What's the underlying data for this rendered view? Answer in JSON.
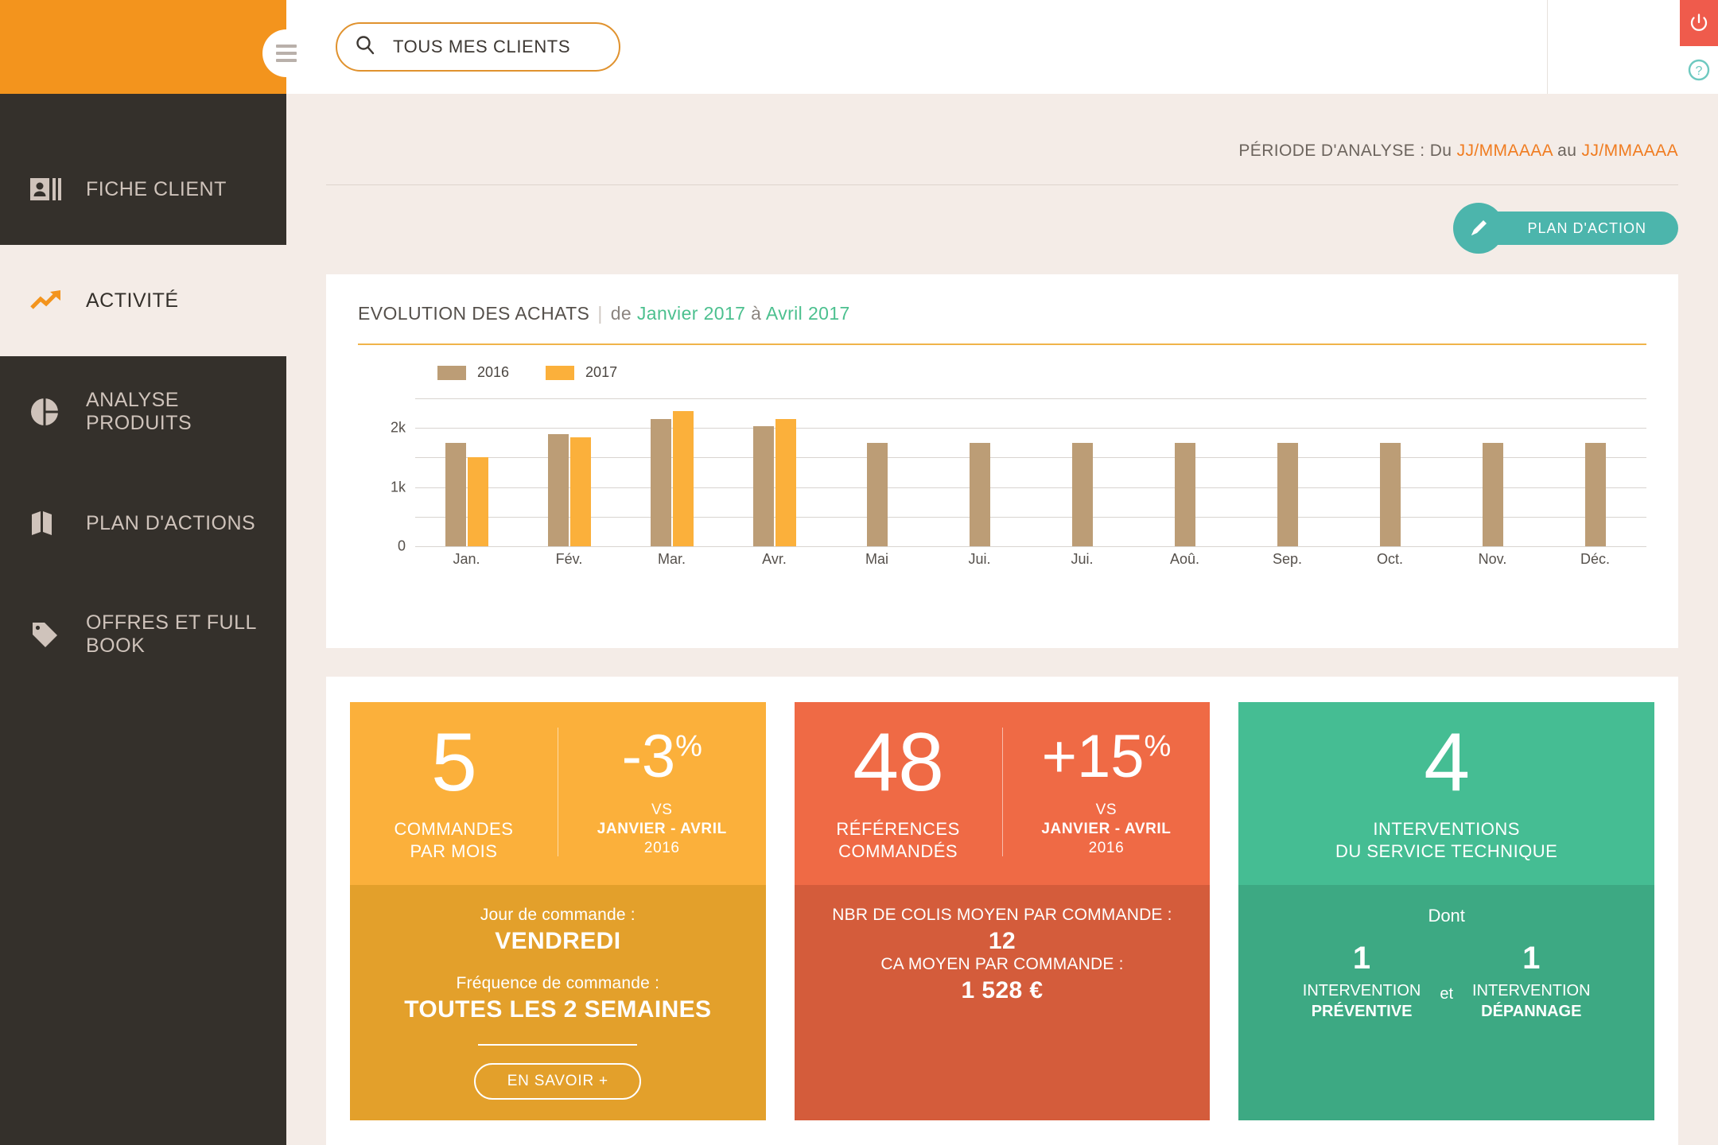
{
  "brand": {
    "accent_orange": "#f3941d",
    "sidebar_bg": "#34302b",
    "page_bg": "#f4ece7"
  },
  "topbar": {
    "hamburger_icon": "hamburger-icon",
    "search": {
      "icon": "search-icon",
      "value": "TOUS MES CLIENTS",
      "placeholder": "TOUS MES CLIENTS"
    },
    "power_icon": "power-icon",
    "help_icon": "help-icon",
    "power_color": "#ef5b4c",
    "help_color": "#6ec9c0"
  },
  "sidebar": {
    "items": [
      {
        "label": "FICHE CLIENT",
        "icon": "contact-card-icon",
        "active": false
      },
      {
        "label": "ACTIVITÉ",
        "icon": "trending-up-icon",
        "active": true
      },
      {
        "label": "ANALYSE PRODUITS",
        "icon": "pie-chart-icon",
        "active": false
      },
      {
        "label": "PLAN D'ACTIONS",
        "icon": "map-icon",
        "active": false
      },
      {
        "label": "OFFRES ET FULL BOOK",
        "icon": "tag-icon",
        "active": false
      }
    ]
  },
  "period": {
    "prefix": "PÉRIODE D'ANALYSE : Du ",
    "from": "JJ/MMAAAA",
    "middle": " au ",
    "to": "JJ/MMAAAA"
  },
  "plan_button": {
    "label": "PLAN D'ACTION",
    "icon": "pencil-icon",
    "color": "#4cb5ac"
  },
  "chart_card": {
    "title": "EVOLUTION DES ACHATS",
    "separator": "|",
    "subtitle_prefix": "de ",
    "subtitle_from": "Janvier 2017",
    "subtitle_mid": " à ",
    "subtitle_to": "Avril 2017"
  },
  "chart_data": {
    "type": "bar",
    "title": "EVOLUTION DES ACHATS",
    "subtitle": "de Janvier 2017 à Avril 2017",
    "xlabel": "",
    "ylabel": "",
    "ylim": [
      0,
      2500
    ],
    "yticks": [
      0,
      500,
      1000,
      1500,
      2000,
      2500
    ],
    "ytick_labels": [
      "0",
      "",
      "1k",
      "",
      "2k",
      ""
    ],
    "grid": true,
    "legend_position": "top-left",
    "categories": [
      "Jan.",
      "Fév.",
      "Mar.",
      "Avr.",
      "Mai",
      "Jui.",
      "Jui.",
      "Aoû.",
      "Sep.",
      "Oct.",
      "Nov.",
      "Déc."
    ],
    "series": [
      {
        "name": "2016",
        "color": "#bc9d76",
        "values": [
          1750,
          1900,
          2150,
          2030,
          1750,
          1750,
          1750,
          1750,
          1750,
          1750,
          1750,
          1750
        ]
      },
      {
        "name": "2017",
        "color": "#fbb03b",
        "values": [
          1500,
          1840,
          2280,
          2150,
          null,
          null,
          null,
          null,
          null,
          null,
          null,
          null
        ]
      }
    ]
  },
  "kpis": [
    {
      "color": "#fbb03b",
      "color_bottom": "#e3a02b",
      "value": "5",
      "caption_line1": "COMMANDES",
      "caption_line2": "PAR MOIS",
      "pct": "-3",
      "pct_symbol": "%",
      "vs_label": "VS",
      "vs_period": "JANVIER - AVRIL",
      "vs_year": "2016",
      "bottom": {
        "label1": "Jour de commande :",
        "value1": "VENDREDI",
        "label2": "Fréquence de commande :",
        "value2": "TOUTES LES 2 SEMAINES",
        "button": "EN SAVOIR +"
      }
    },
    {
      "color": "#ef6a45",
      "color_bottom": "#d45c3b",
      "value": "48",
      "caption_line1": "RÉFÉRENCES",
      "caption_line2": "COMMANDÉS",
      "pct": "+15",
      "pct_symbol": "%",
      "vs_label": "VS",
      "vs_period": "JANVIER - AVRIL",
      "vs_year": "2016",
      "bottom": {
        "label1": "NBR DE COLIS MOYEN PAR COMMANDE :",
        "value1": "12",
        "label2": "CA MOYEN PAR COMMANDE :",
        "value2": "1 528 €"
      }
    },
    {
      "color": "#45bd93",
      "color_bottom": "#3da983",
      "value": "4",
      "caption_line1": "INTERVENTIONS",
      "caption_line2": "DU SERVICE TECHNIQUE",
      "bottom": {
        "dont": "Dont",
        "num1": "1",
        "cap1_line1": "INTERVENTION",
        "cap1_line2": "PRÉVENTIVE",
        "et": "et",
        "num2": "1",
        "cap2_line1": "INTERVENTION",
        "cap2_line2": "DÉPANNAGE"
      }
    }
  ]
}
